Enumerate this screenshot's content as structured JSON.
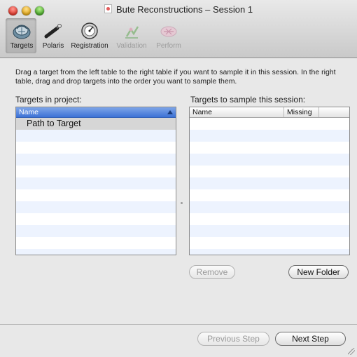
{
  "window": {
    "title": "Bute Reconstructions – Session 1"
  },
  "toolbar": {
    "items": [
      {
        "label": "Targets",
        "icon": "targets-icon",
        "state": "selected"
      },
      {
        "label": "Polaris",
        "icon": "polaris-probe-icon",
        "state": "enabled"
      },
      {
        "label": "Registration",
        "icon": "registration-dial-icon",
        "state": "enabled"
      },
      {
        "label": "Validation",
        "icon": "validation-icon",
        "state": "disabled"
      },
      {
        "label": "Perform",
        "icon": "perform-icon",
        "state": "disabled"
      }
    ]
  },
  "instructions": "Drag a target from the left table to the right table if you want to sample it in this session. In the right table, drag and drop targets into the order you want to sample them.",
  "left_table": {
    "label": "Targets in project:",
    "header": "Name",
    "rows": [
      "Path to Target"
    ]
  },
  "right_table": {
    "label": "Targets to sample this session:",
    "headers": [
      "Name",
      "Missing"
    ],
    "rows": []
  },
  "buttons": {
    "remove": "Remove",
    "new_folder": "New Folder",
    "previous_step": "Previous Step",
    "next_step": "Next Step"
  },
  "colors": {
    "header_selected": "#3d72d6",
    "row_stripe": "#edf3fe",
    "row_highlight": "#d6d6d6"
  }
}
